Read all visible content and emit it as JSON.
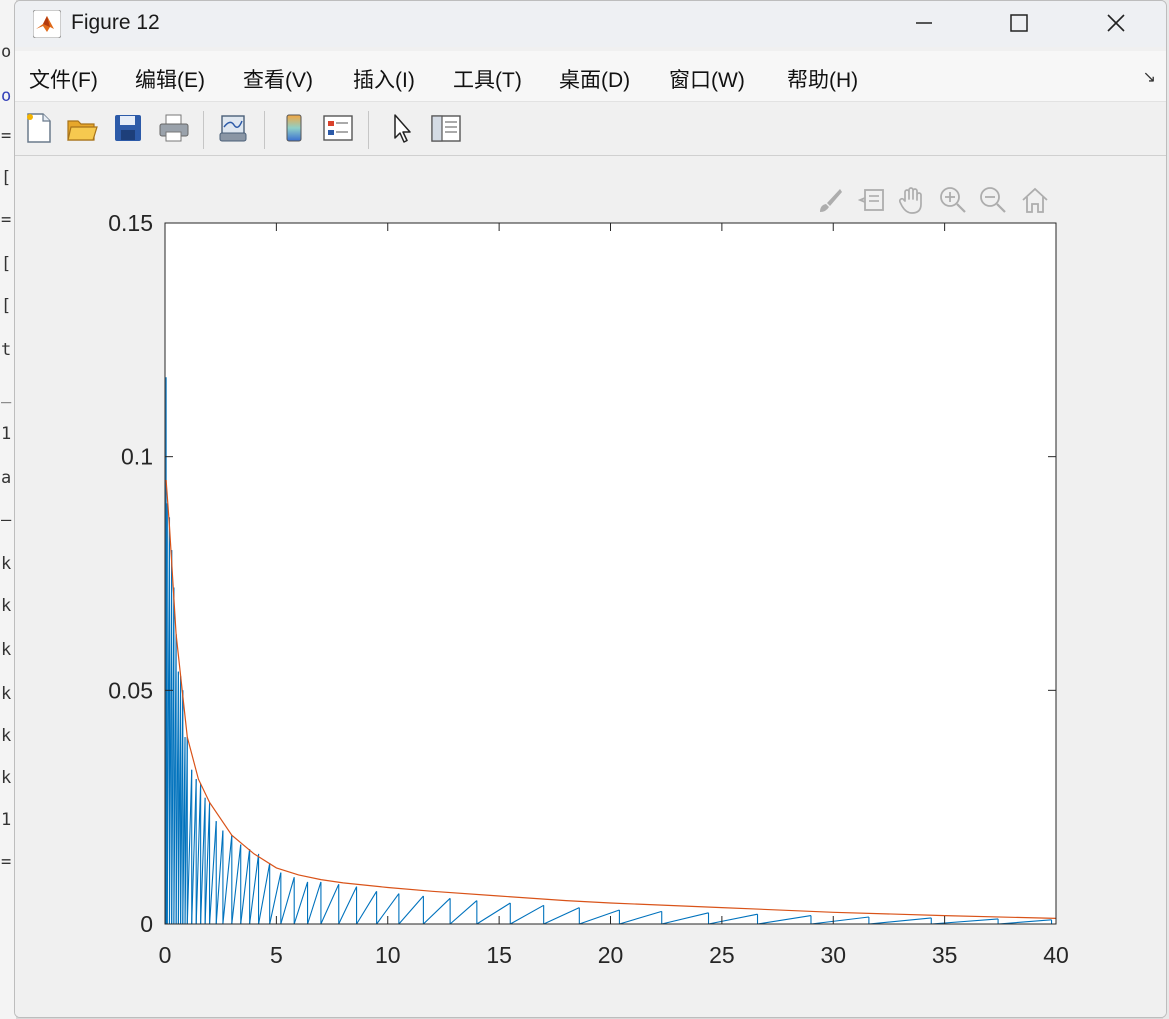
{
  "window": {
    "title": "Figure 12",
    "minimize_glyph": "—",
    "maximize_glyph": "☐",
    "close_glyph": "✕"
  },
  "background_text": [
    "o",
    "o",
    "=",
    "[",
    "=",
    "[",
    "[",
    "t",
    "_",
    "1",
    "a",
    "—",
    "k",
    "k",
    "k",
    "k",
    "k",
    "k",
    "1",
    "="
  ],
  "menu": {
    "items": [
      "文件(F)",
      "编辑(E)",
      "查看(V)",
      "插入(I)",
      "工具(T)",
      "桌面(D)",
      "窗口(W)",
      "帮助(H)"
    ],
    "overflow_glyph": "↘"
  },
  "toolbar": {
    "icons": [
      "new-figure-icon",
      "open-file-icon",
      "save-icon",
      "print-icon",
      "link-plot-icon",
      "insert-colorbar-icon",
      "insert-legend-icon",
      "edit-plot-arrow-icon",
      "property-inspector-icon"
    ]
  },
  "axes_toolbar": {
    "icons": [
      "brush-icon",
      "data-tips-icon",
      "pan-hand-icon",
      "zoom-in-icon",
      "zoom-out-icon",
      "home-icon"
    ]
  },
  "chart_data": {
    "type": "line",
    "title": "",
    "xlabel": "",
    "ylabel": "",
    "xlim": [
      0,
      40
    ],
    "ylim": [
      0,
      0.15
    ],
    "xticks": [
      0,
      5,
      10,
      15,
      20,
      25,
      30,
      35,
      40
    ],
    "xtick_labels": [
      "0",
      "5",
      "10",
      "15",
      "20",
      "25",
      "30",
      "35",
      "40"
    ],
    "yticks": [
      0,
      0.05,
      0.1,
      0.15
    ],
    "ytick_labels": [
      "0",
      "0.05",
      "0.1",
      "0.15"
    ],
    "grid": false,
    "series": [
      {
        "color": "#0072bd",
        "style": "sawtooth oscillation decaying with x, dense near x=0",
        "x": [
          0.05,
          0.1,
          0.2,
          0.3,
          0.4,
          0.5,
          0.6,
          0.7,
          0.8,
          0.9,
          1.0,
          1.2,
          1.4,
          1.6,
          1.8,
          2.0,
          2.3,
          2.6,
          3.0,
          3.4,
          3.8,
          4.2,
          4.7,
          5.2,
          5.8,
          6.4,
          7.0,
          7.8,
          8.6,
          9.5,
          10.5,
          11.6,
          12.8,
          14.0,
          15.5,
          17.0,
          18.6,
          20.4,
          22.3,
          24.4,
          26.6,
          29.0,
          31.6,
          34.4,
          37.4,
          39.8
        ],
        "y": [
          0.117,
          0.09,
          0.087,
          0.08,
          0.072,
          0.062,
          0.054,
          0.053,
          0.05,
          0.04,
          0.04,
          0.033,
          0.031,
          0.03,
          0.027,
          0.026,
          0.022,
          0.02,
          0.019,
          0.017,
          0.016,
          0.015,
          0.013,
          0.011,
          0.01,
          0.009,
          0.009,
          0.0085,
          0.008,
          0.007,
          0.0065,
          0.006,
          0.0055,
          0.005,
          0.0045,
          0.004,
          0.0035,
          0.003,
          0.0027,
          0.0024,
          0.0021,
          0.0018,
          0.0015,
          0.0013,
          0.0011,
          0.0009
        ]
      },
      {
        "color": "#d95319",
        "style": "decaying envelope",
        "x": [
          0.05,
          0.2,
          0.5,
          1.0,
          1.5,
          2.0,
          3.0,
          4.0,
          5.0,
          6.0,
          7.0,
          8.0,
          10.0,
          12.0,
          15.0,
          18.0,
          20.0,
          25.0,
          30.0,
          35.0,
          40.0
        ],
        "y": [
          0.095,
          0.085,
          0.062,
          0.04,
          0.031,
          0.026,
          0.019,
          0.015,
          0.012,
          0.0105,
          0.0095,
          0.0088,
          0.0078,
          0.007,
          0.006,
          0.005,
          0.0045,
          0.0035,
          0.0025,
          0.0018,
          0.0012
        ]
      }
    ]
  }
}
